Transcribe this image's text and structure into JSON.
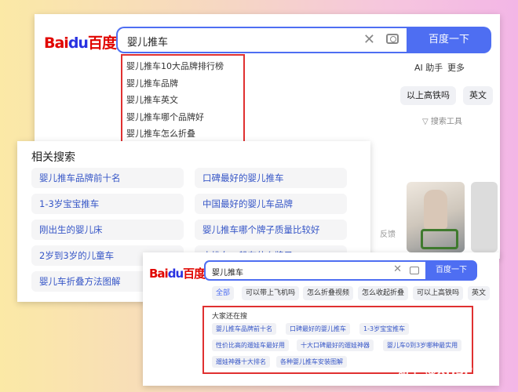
{
  "top_search": {
    "logo_text": "Bai",
    "logo_paw": "du",
    "logo_cn": "百度",
    "query": "婴儿推车",
    "clear_icon": "close-icon",
    "camera_icon": "camera-icon",
    "search_button": "百度一下",
    "suggestions": [
      "婴儿推车10大品牌排行榜",
      "婴儿推车品牌",
      "婴儿推车英文",
      "婴儿推车哪个品牌好",
      "婴儿推车怎么折叠"
    ],
    "helper_label": "AI 助手",
    "more_label": "更多",
    "chips": [
      "以上高铁吗",
      "英文"
    ],
    "tools_label": "搜索工具",
    "feedback_label": "反馈"
  },
  "related": {
    "title": "相关搜索",
    "items": [
      "婴儿推车品牌前十名",
      "口碑最好的婴儿推车",
      "1-3岁宝宝推车",
      "中国最好的婴儿车品牌",
      "刚出生的婴儿床",
      "婴儿推车哪个牌子质量比较好",
      "2岁到3岁的儿童车",
      "小推车一般有什么牌子",
      "婴儿车折叠方法图解",
      ""
    ]
  },
  "bottom_search": {
    "logo_text": "Bai",
    "logo_paw": "du",
    "logo_cn": "百度",
    "query": "婴儿推车",
    "search_button": "百度一下",
    "tabs": [
      "全部",
      "可以带上飞机吗",
      "怎么折叠视频",
      "怎么收起折叠",
      "可以上高铁吗",
      "英文"
    ],
    "others_heading": "大家还在搜",
    "keywords": [
      "婴儿推车品牌前十名",
      "口碑最好的婴儿推车",
      "1-3岁宝宝推车",
      "性价比高的遛娃车最好用",
      "十大口碑最好的遛娃神器",
      "婴儿车0到3岁哪种最实用",
      "遛娃神器十大排名",
      "各种婴儿推车安装图解"
    ]
  },
  "watermark": "知乎 @XHSPlus",
  "colors": {
    "brand_blue": "#4e6ef2",
    "highlight_red": "#e03030",
    "link_blue": "#3656c7"
  }
}
